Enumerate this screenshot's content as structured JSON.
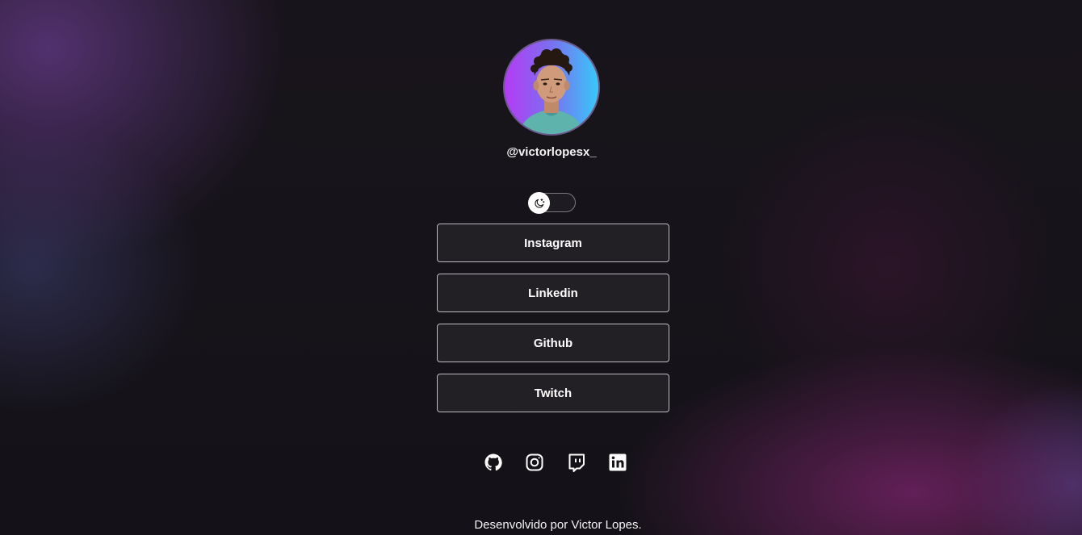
{
  "profile": {
    "username": "@victorlopesx_"
  },
  "theme_toggle": {
    "icon": "moon-icon",
    "state": "dark"
  },
  "links": [
    {
      "label": "Instagram"
    },
    {
      "label": "Linkedin"
    },
    {
      "label": "Github"
    },
    {
      "label": "Twitch"
    }
  ],
  "social_icons": [
    {
      "icon": "github-icon"
    },
    {
      "icon": "instagram-icon"
    },
    {
      "icon": "twitch-icon"
    },
    {
      "icon": "linkedin-icon"
    }
  ],
  "footer": {
    "text": "Desenvolvido por Victor Lopes."
  },
  "colors": {
    "avatar_gradient_start": "#b43cf4",
    "avatar_gradient_end": "#38c8f8",
    "button_border": "#bdbdc2",
    "button_background": "#242126"
  }
}
